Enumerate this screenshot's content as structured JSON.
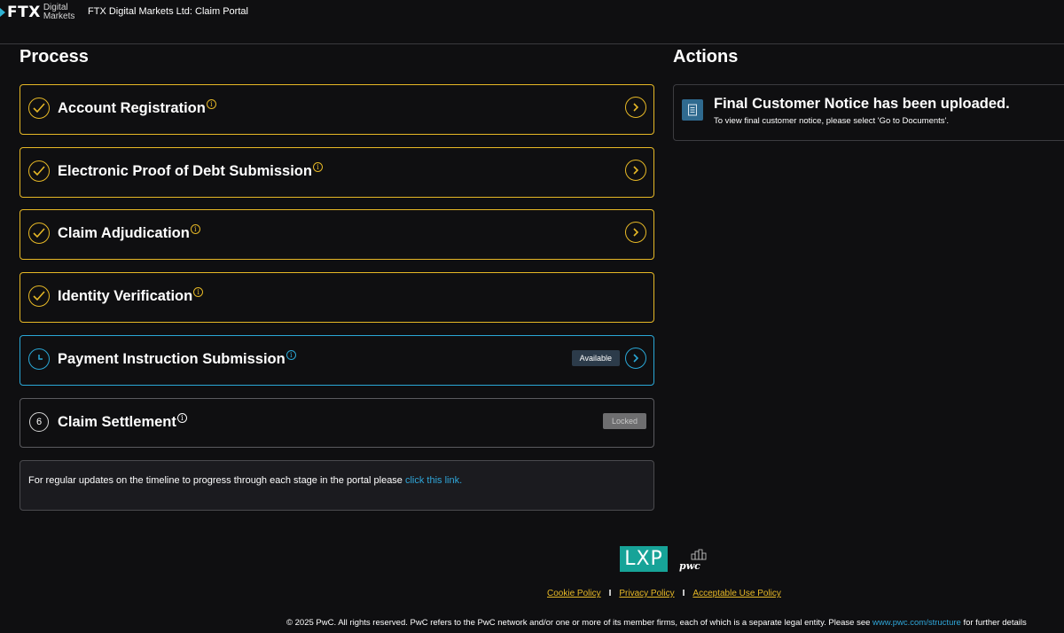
{
  "header": {
    "logo_main": "FTX",
    "logo_sub_line1": "Digital",
    "logo_sub_line2": "Markets",
    "title": "FTX Digital Markets Ltd: Claim Portal"
  },
  "process": {
    "title": "Process",
    "steps": [
      {
        "label": "Account Registration",
        "status": "complete",
        "status_icon": "check-circle-icon",
        "has_chevron": true
      },
      {
        "label": "Electronic Proof of Debt Submission",
        "status": "complete",
        "status_icon": "check-circle-icon",
        "has_chevron": true
      },
      {
        "label": "Claim Adjudication",
        "status": "complete",
        "status_icon": "check-circle-icon",
        "has_chevron": true
      },
      {
        "label": "Identity Verification",
        "status": "complete",
        "status_icon": "check-circle-icon",
        "has_chevron": false
      },
      {
        "label": "Payment Instruction Submission",
        "status": "active",
        "status_icon": "clock-icon",
        "badge": "Available",
        "has_chevron": true
      },
      {
        "label": "Claim Settlement",
        "status": "locked",
        "step_number": "6",
        "badge": "Locked",
        "has_chevron": false
      }
    ],
    "info_text": "For regular updates on the timeline to progress through each stage in the portal please ",
    "info_link": "click this link."
  },
  "actions": {
    "title": "Actions",
    "notice_title": "Final Customer Notice has been uploaded.",
    "notice_sub": "To view final customer notice, please select 'Go to Documents'."
  },
  "footer": {
    "lxp_logo": "LXP",
    "pwc_logo": "pwc",
    "links": [
      "Cookie Policy",
      "Privacy Policy",
      "Acceptable Use Policy"
    ],
    "separator": "I",
    "copyright_text": "© 2025 PwC. All rights reserved. PwC refers to the PwC network and/or one or more of its member firms, each of which is a separate legal entity. Please see ",
    "copyright_link": "www.pwc.com/structure",
    "copyright_tail": " for further details"
  },
  "colors": {
    "background": "#0f0f11",
    "complete": "#e6b826",
    "active": "#2aa7d6",
    "link": "#2fa6d9",
    "lxp": "#17a398"
  }
}
